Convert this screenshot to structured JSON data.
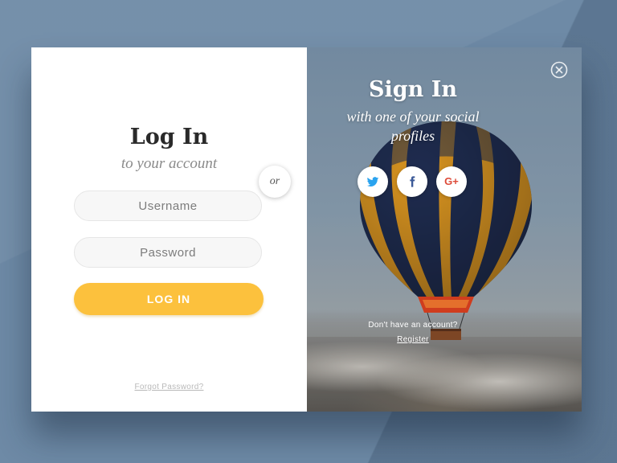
{
  "login": {
    "title": "Log In",
    "subtitle": "to your account",
    "username_placeholder": "Username",
    "password_placeholder": "Password",
    "button_label": "LOG IN",
    "forgot_link": "Forgot Password?"
  },
  "divider": {
    "label": "or"
  },
  "signin": {
    "title": "Sign In",
    "subtitle": "with one of your social profiles",
    "social": [
      {
        "icon": "twitter-icon",
        "color": "#2aa3ef"
      },
      {
        "icon": "facebook-icon",
        "color": "#3b5998"
      },
      {
        "icon": "google-plus-icon",
        "color": "#dd4b39",
        "label": "G+"
      }
    ],
    "no_account_text": "Don't have an account?",
    "register_link": "Register"
  },
  "colors": {
    "background": "#6e8aa6",
    "accent": "#fcc13d",
    "panel": "#ffffff"
  },
  "close_icon": "close-icon"
}
